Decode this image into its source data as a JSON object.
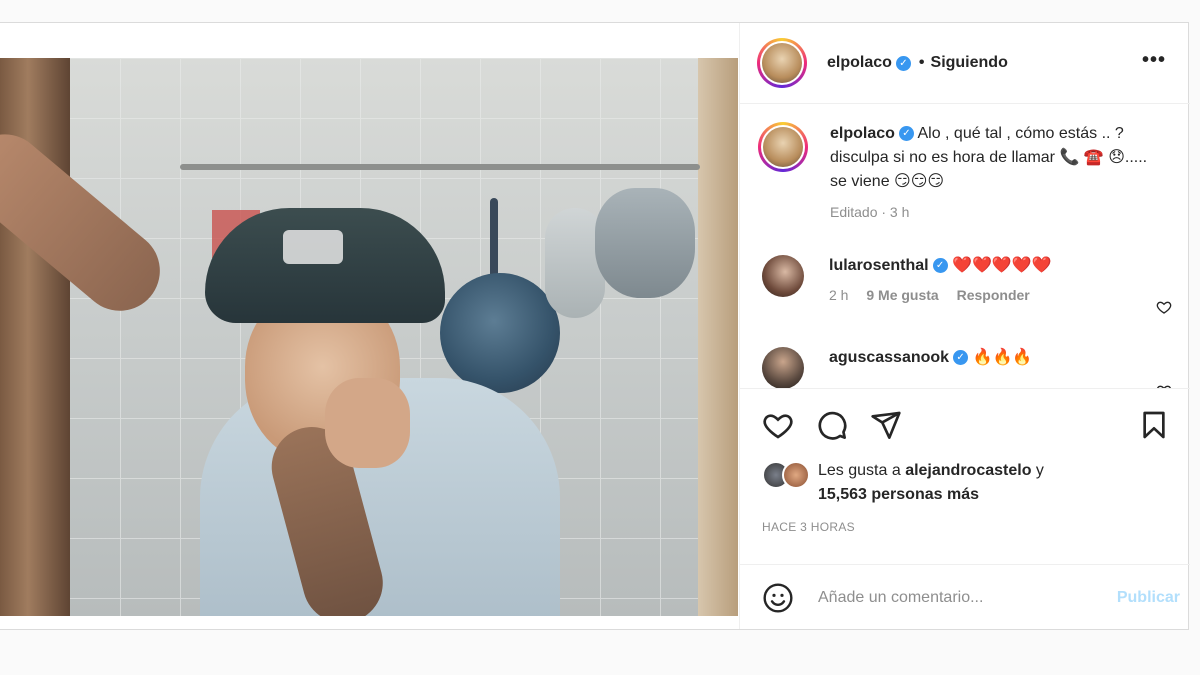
{
  "post": {
    "author": "elpolaco",
    "separator": "•",
    "follow_status": "Siguiendo",
    "more_icon": "•••",
    "caption": {
      "username": "elpolaco",
      "text": "Alo , qué tal , cómo estás .. ?disculpa si no es hora de llamar 📞 ☎️ 😞..... se viene 😏😏😏",
      "edited": "Editado · 3 h"
    },
    "comments": [
      {
        "username": "lularosenthal",
        "text": "❤️❤️❤️❤️❤️",
        "time": "2 h",
        "likes": "9 Me gusta",
        "reply": "Responder"
      },
      {
        "username": "aguscassanook",
        "text": "🔥🔥🔥"
      }
    ],
    "likes": {
      "prefix": "Les gusta a",
      "user": "alejandrocastelo",
      "joiner": "y",
      "others": "15,563 personas más"
    },
    "timestamp": "HACE 3 HORAS",
    "add_comment": {
      "placeholder": "Añade un comentario...",
      "publish": "Publicar"
    }
  },
  "colors": {
    "link_blue_disabled": "#b2dffc",
    "verified_blue": "#3897f0",
    "muted": "#8e8e8e"
  }
}
